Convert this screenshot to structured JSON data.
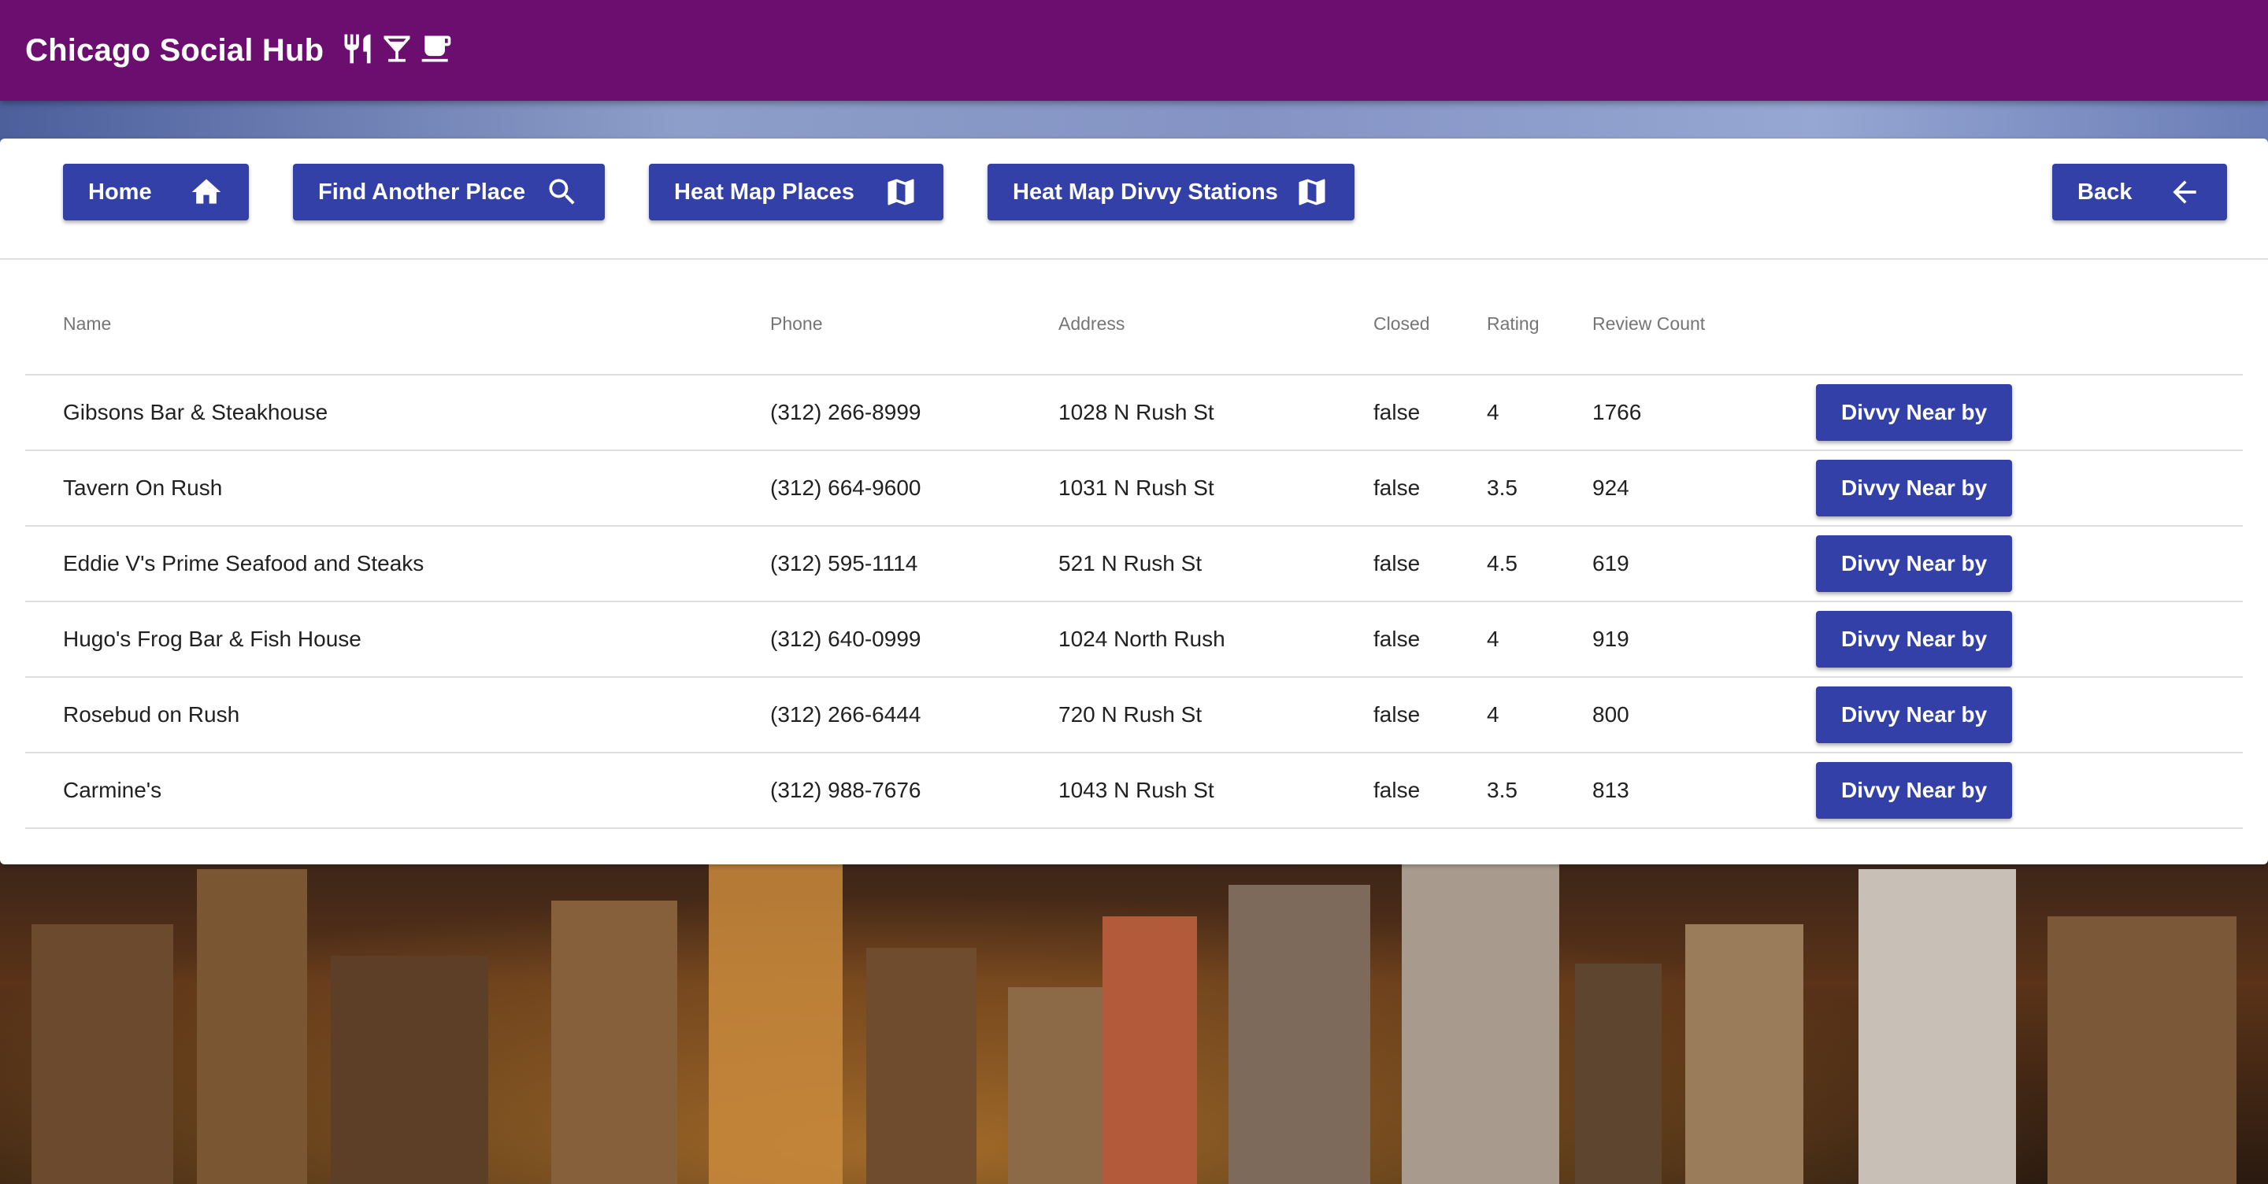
{
  "app": {
    "title": "Chicago Social Hub",
    "icons": [
      "restaurant-icon",
      "cocktail-icon",
      "coffee-icon"
    ],
    "bar_color": "#6c0e70"
  },
  "toolbar": {
    "home_label": "Home",
    "find_label": "Find Another Place",
    "heat_places_label": "Heat Map Places",
    "heat_divvy_label": "Heat Map Divvy Stations",
    "back_label": "Back",
    "button_color": "#3340a8"
  },
  "table": {
    "headers": {
      "name": "Name",
      "phone": "Phone",
      "address": "Address",
      "closed": "Closed",
      "rating": "Rating",
      "review_count": "Review Count"
    },
    "action_label": "Divvy Near by",
    "rows": [
      {
        "name": "Gibsons Bar & Steakhouse",
        "phone": "(312) 266-8999",
        "address": "1028 N Rush St",
        "closed": "false",
        "rating": "4",
        "review_count": "1766"
      },
      {
        "name": "Tavern On Rush",
        "phone": "(312) 664-9600",
        "address": "1031 N Rush St",
        "closed": "false",
        "rating": "3.5",
        "review_count": "924"
      },
      {
        "name": "Eddie V's Prime Seafood and Steaks",
        "phone": "(312) 595-1114",
        "address": "521 N Rush St",
        "closed": "false",
        "rating": "4.5",
        "review_count": "619"
      },
      {
        "name": "Hugo's Frog Bar & Fish House",
        "phone": "(312) 640-0999",
        "address": "1024 North Rush",
        "closed": "false",
        "rating": "4",
        "review_count": "919"
      },
      {
        "name": "Rosebud on Rush",
        "phone": "(312) 266-6444",
        "address": "720 N Rush St",
        "closed": "false",
        "rating": "4",
        "review_count": "800"
      },
      {
        "name": "Carmine's",
        "phone": "(312) 988-7676",
        "address": "1043 N Rush St",
        "closed": "false",
        "rating": "3.5",
        "review_count": "813"
      }
    ]
  }
}
